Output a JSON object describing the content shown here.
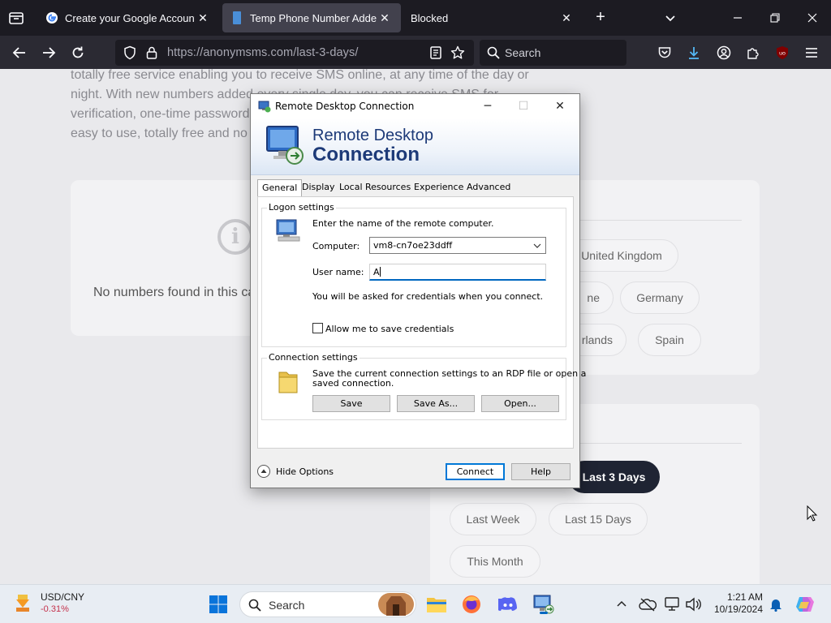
{
  "browser": {
    "tabs": [
      {
        "title": "Create your Google Account",
        "active": false
      },
      {
        "title": "Temp Phone Number Added In",
        "active": true
      },
      {
        "title": "Blocked",
        "active": false
      }
    ],
    "url_host": "https://anonymsms.com",
    "url_path": "/last-3-days/",
    "search_placeholder": "Search"
  },
  "page": {
    "intro_lines": [
      "totally free service enabling you to receive SMS online, at any time of the day or",
      "night. With new numbers added every single day, you can receive SMS for",
      "verification, one-time password",
      "easy to use, totally free and no r"
    ],
    "empty_message": "No numbers found in this ca",
    "countries": [
      "United Kingdom",
      "ne",
      "Germany",
      "rlands",
      "Spain"
    ],
    "periods": [
      "Last 3 Days",
      "Last Week",
      "Last 15 Days",
      "This Month"
    ],
    "active_period": "Last 3 Days"
  },
  "rdp": {
    "window_title": "Remote Desktop Connection",
    "banner_line1": "Remote Desktop",
    "banner_line2": "Connection",
    "tabs": [
      "General",
      "Display",
      "Local Resources",
      "Experience",
      "Advanced"
    ],
    "logon_group": "Logon settings",
    "logon_prompt": "Enter the name of the remote computer.",
    "computer_label": "Computer:",
    "computer_value": "vm8-cn7oe23ddff",
    "username_label": "User name:",
    "username_value": "A",
    "credentials_note": "You will be asked for credentials when you connect.",
    "save_credentials_label": "Allow me to save credentials",
    "connection_group": "Connection settings",
    "connection_text_1": "Save the current connection settings to an RDP file or open a",
    "connection_text_2": "saved connection.",
    "save_btn": "Save",
    "save_as_btn": "Save As...",
    "open_btn": "Open...",
    "hide_options": "Hide Options",
    "connect_btn": "Connect",
    "help_btn": "Help"
  },
  "taskbar": {
    "ticker_name": "USD/CNY",
    "ticker_change": "-0.31%",
    "search_label": "Search",
    "time": "1:21 AM",
    "date": "10/19/2024"
  },
  "colors": {
    "chrome_dark": "#1c1b22",
    "navbar": "#2b2a33",
    "active_pill": "#1f2433",
    "rdp_title_blue": "#1d3a78",
    "accent": "#0067c0"
  }
}
